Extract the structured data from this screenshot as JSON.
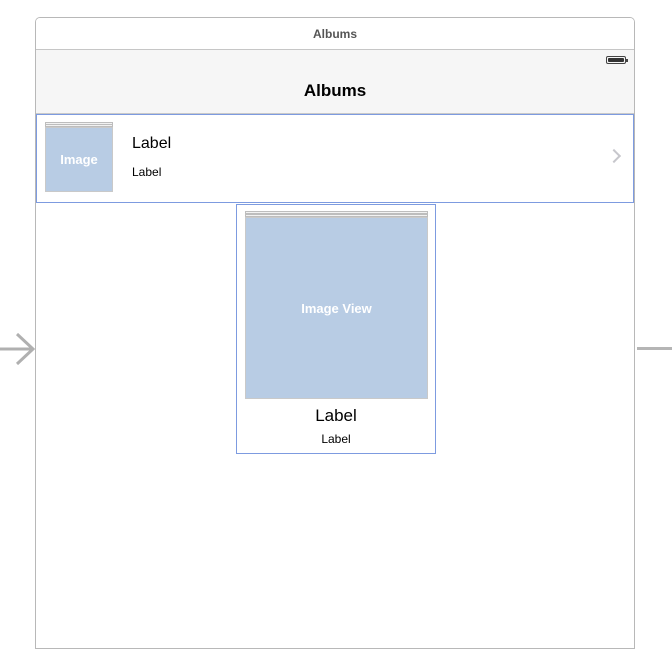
{
  "scene": {
    "title": "Albums"
  },
  "navbar": {
    "title": "Albums"
  },
  "table_cell": {
    "image_label": "Image",
    "title": "Label",
    "subtitle": "Label"
  },
  "collection_cell": {
    "image_label": "Image View",
    "title": "Label",
    "subtitle": "Label"
  },
  "colors": {
    "selection_border": "#7d9be0",
    "image_placeholder": "#b8cce4",
    "navbar_bg": "#f6f6f6"
  },
  "icons": [
    "battery-icon",
    "chevron-right-icon",
    "segue-arrow-icon"
  ]
}
